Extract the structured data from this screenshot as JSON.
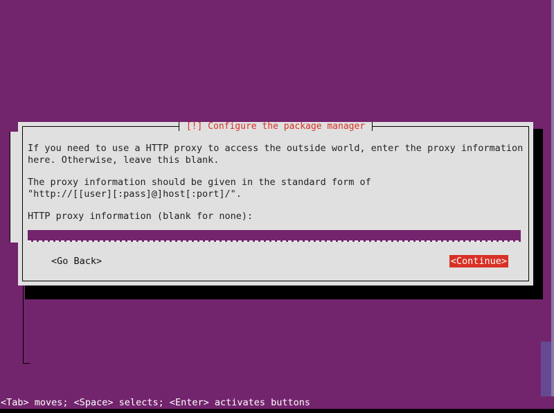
{
  "screen": {
    "background_color": "#72246c",
    "accent_red": "#d93025",
    "dialog_bg": "#e0e0e0"
  },
  "dialog": {
    "title": "[!] Configure the package manager",
    "paragraphs": [
      "If you need to use a HTTP proxy to access the outside world, enter the proxy information",
      "here. Otherwise, leave this blank.",
      "The proxy information should be given in the standard form of",
      "\"http://[[user][:pass]@]host[:port]/\"."
    ],
    "prompt_label": "HTTP proxy information (blank for none):",
    "input": {
      "value": "",
      "placeholder": ""
    },
    "buttons": {
      "go_back": "<Go Back>",
      "continue": "<Continue>"
    }
  },
  "statusbar": {
    "text": "<Tab> moves; <Space> selects; <Enter> activates buttons"
  }
}
